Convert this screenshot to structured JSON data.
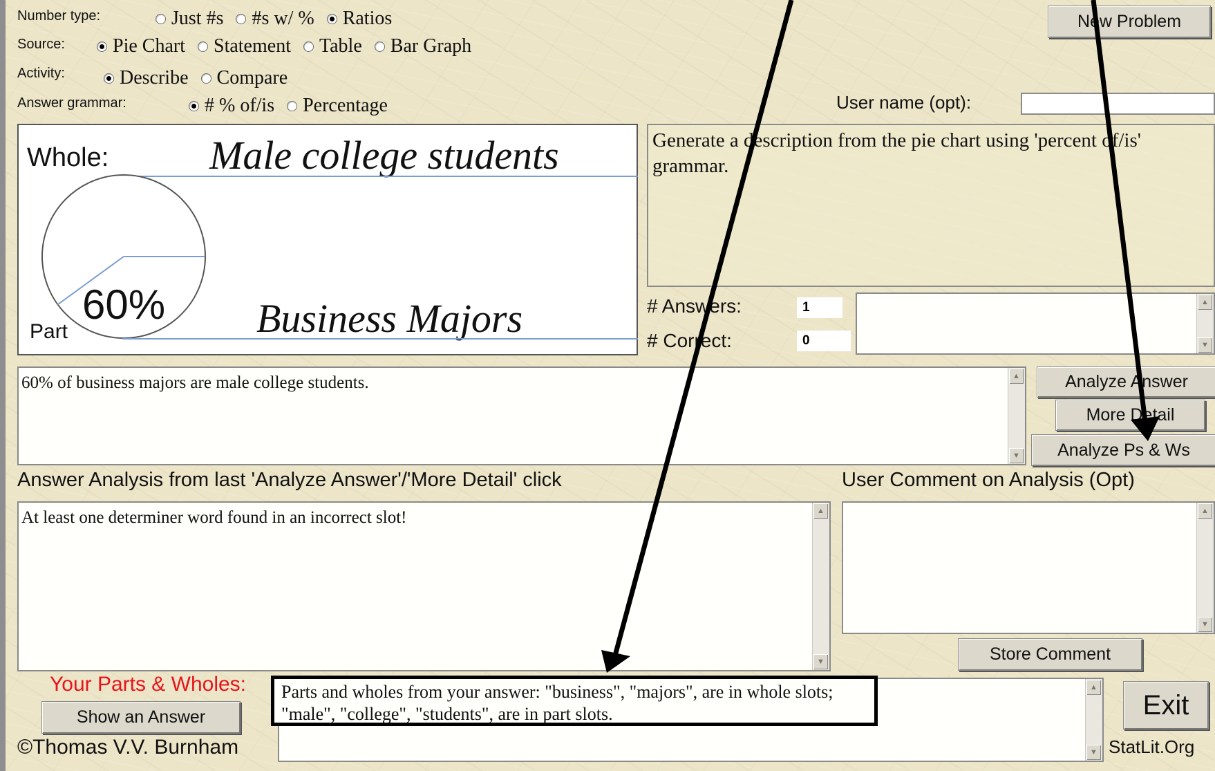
{
  "controls": {
    "number_type_label": "Number type:",
    "number_type_options": [
      "Just #s",
      "#s w/ %",
      "Ratios"
    ],
    "source_label": "Source:",
    "source_options": [
      "Pie Chart",
      "Statement",
      "Table",
      "Bar Graph"
    ],
    "activity_label": "Activity:",
    "activity_options": [
      "Describe",
      "Compare"
    ],
    "grammar_label": "Answer grammar:",
    "grammar_options": [
      "# % of/is",
      "Percentage"
    ],
    "new_problem": "New Problem",
    "user_name_label": "User name (opt):",
    "user_name_value": ""
  },
  "pie_panel": {
    "whole_label": "Whole:",
    "whole_value": "Male college students",
    "percent": "60%",
    "part_label": "Part",
    "part_value": "Business Majors",
    "part_fraction": 0.6
  },
  "instructions": "Generate a description from the pie chart using 'percent of/is' grammar.",
  "stats": {
    "answers_label": "# Answers:",
    "answers_value": "1",
    "correct_label": "# Correct:",
    "correct_value": "0"
  },
  "answer_text": "60% of business majors are male college students.",
  "buttons": {
    "analyze_answer": "Analyze Answer",
    "more_detail": "More Detail",
    "analyze_ps_ws": "Analyze Ps & Ws",
    "store_comment": "Store Comment",
    "show_answer": "Show an Answer",
    "exit": "Exit"
  },
  "analysis": {
    "heading": "Answer Analysis from last 'Analyze Answer'/'More Detail' click",
    "text": "At least one determiner word found in an incorrect slot!"
  },
  "comment": {
    "heading": "User Comment on Analysis (Opt)",
    "text": ""
  },
  "parts_wholes": {
    "label": "Your Parts & Wholes:",
    "text": "Parts and wholes from your answer: \"business\", \"majors\", are in whole slots; \"male\", \"college\", \"students\", are in part slots."
  },
  "footer": {
    "copyright": "©Thomas V.V. Burnham",
    "site": "StatLit.Org"
  },
  "colors": {
    "background": "#ece5c8",
    "accent_red": "#e8141a",
    "guide_line": "#7a9ed0"
  }
}
